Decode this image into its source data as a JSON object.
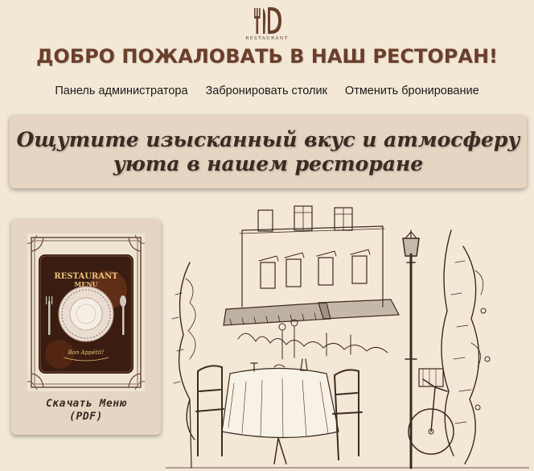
{
  "logo": {
    "icon": "restaurant-logo-icon",
    "text": "RESTAURANT"
  },
  "header": {
    "title": "ДОБРО ПОЖАЛОВАТЬ В НАШ РЕСТОРАН!"
  },
  "nav": {
    "items": [
      {
        "label": "Панель администратора"
      },
      {
        "label": "Забронировать столик"
      },
      {
        "label": "Отменить бронирование"
      }
    ]
  },
  "banner": {
    "line1": "Ощутите изысканный вкус и атмосферу",
    "line2": "уюта в нашем ресторане"
  },
  "menu_card": {
    "image_title_line1": "RESTAURANT",
    "image_title_line2": "MENU",
    "image_caption": "Bon Appétit!",
    "link_line1": "Скачать Меню",
    "link_line2": "(PDF)"
  },
  "colors": {
    "background": "#f3e8d6",
    "card": "#e5d5c2",
    "title": "#6b3f2a",
    "ink": "#3b2a22"
  }
}
